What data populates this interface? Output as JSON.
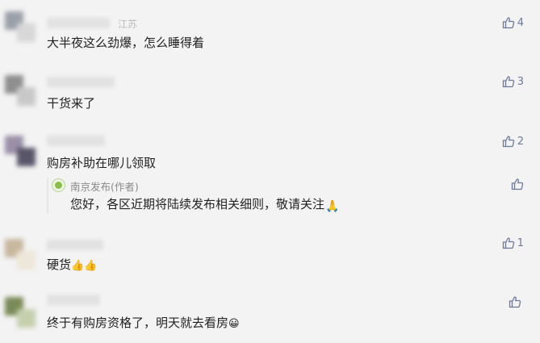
{
  "comments": [
    {
      "location": "江苏",
      "text": "大半夜这么劲爆，怎么睡得着",
      "likes": "4",
      "avatar_colors": [
        "#9aa0aa",
        "#d7d7d7"
      ]
    },
    {
      "text": "干货来了",
      "likes": "3",
      "avatar_colors": [
        "#8e8e8e",
        "#c8c8c8"
      ]
    },
    {
      "text": "购房补助在哪儿领取",
      "likes": "2",
      "avatar_colors": [
        "#9b8fa8",
        "#5a566a"
      ],
      "reply": {
        "author": "南京发布(作者)",
        "text": "您好，各区近期将陆续发布相关细则，敬请关注",
        "emoji": "🙏"
      }
    },
    {
      "text": "硬货",
      "emoji": "👍👍",
      "likes": "1",
      "avatar_colors": [
        "#c7b79e",
        "#eee6d9"
      ]
    },
    {
      "text": "终于有购房资格了，明天就去看房",
      "emoji": "😀",
      "likes": "",
      "avatar_colors": [
        "#7a8a58",
        "#c5cfae"
      ]
    }
  ],
  "icons": {
    "like": "thumbs-up-icon",
    "reply_logo": "nanjing-release-logo"
  },
  "colors": {
    "background": "#f3f3f3",
    "like": "#6b7a9b",
    "text": "#222222",
    "meta": "#8a8a8a"
  }
}
